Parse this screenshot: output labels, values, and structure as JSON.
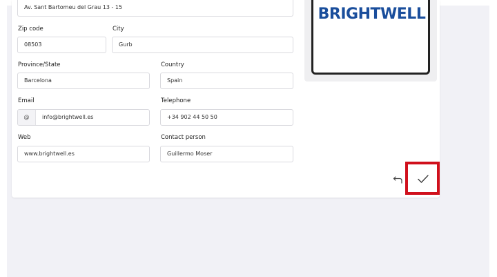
{
  "form": {
    "address": {
      "value": "Av. Sant Bartomeu del Grau 13 - 15"
    },
    "zip": {
      "label": "Zip code",
      "value": "08503"
    },
    "city": {
      "label": "City",
      "value": "Gurb"
    },
    "province": {
      "label": "Province/State",
      "value": "Barcelona"
    },
    "country": {
      "label": "Country",
      "value": "Spain"
    },
    "email": {
      "label": "Email",
      "addon": "@",
      "value": "info@brightwell.es"
    },
    "telephone": {
      "label": "Telephone",
      "value": "+34 902 44 50 50"
    },
    "web": {
      "label": "Web",
      "value": "www.brightwell.es"
    },
    "contact": {
      "label": "Contact person",
      "value": "Guillermo Moser"
    }
  },
  "logo": {
    "text": "BRIGHTWELL",
    "color": "#1a4e9c"
  },
  "actions": {
    "back_icon": "undo-arrow-icon",
    "confirm_icon": "checkmark-icon",
    "highlight_color": "#d0101c"
  }
}
